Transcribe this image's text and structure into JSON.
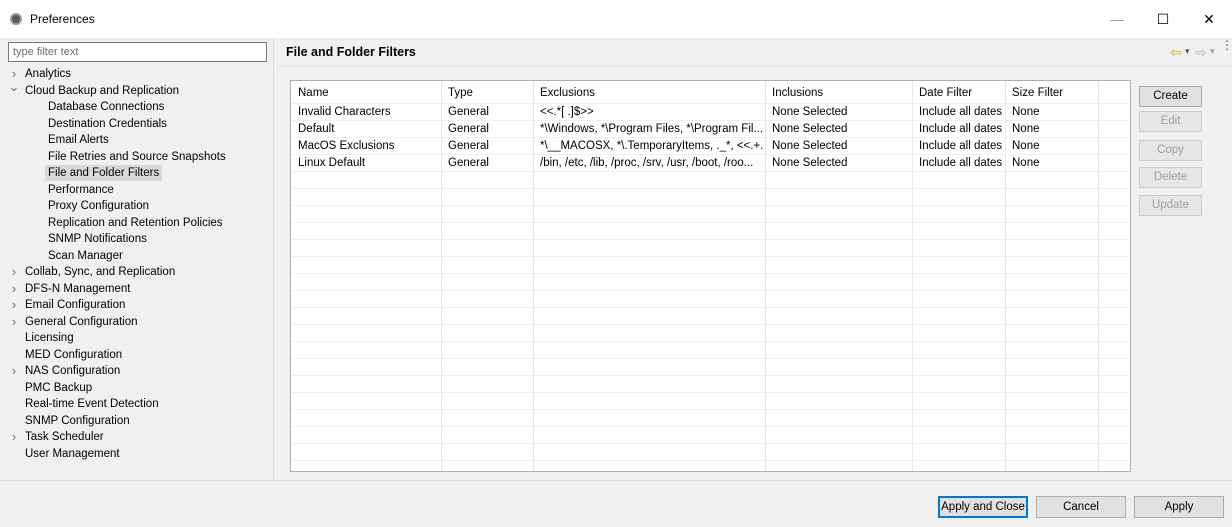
{
  "window": {
    "title": "Preferences",
    "minimize_glyph": "—",
    "maximize_glyph": "☐",
    "close_glyph": "✕"
  },
  "filter": {
    "placeholder": "type filter text",
    "value": ""
  },
  "tree": [
    {
      "label": "Analytics",
      "twisty": ">"
    },
    {
      "label": "Cloud Backup and Replication",
      "twisty": "v"
    },
    {
      "label": "Database Connections",
      "twisty": ""
    },
    {
      "label": "Destination Credentials",
      "twisty": ""
    },
    {
      "label": "Email Alerts",
      "twisty": ""
    },
    {
      "label": "File Retries and Source Snapshots",
      "twisty": ""
    },
    {
      "label": "File and Folder Filters",
      "twisty": "",
      "selected": true
    },
    {
      "label": "Performance",
      "twisty": ""
    },
    {
      "label": "Proxy Configuration",
      "twisty": ""
    },
    {
      "label": "Replication and Retention Policies",
      "twisty": ""
    },
    {
      "label": "SNMP Notifications",
      "twisty": ""
    },
    {
      "label": "Scan Manager",
      "twisty": ""
    },
    {
      "label": "Collab, Sync, and Replication",
      "twisty": ">"
    },
    {
      "label": "DFS-N Management",
      "twisty": ">"
    },
    {
      "label": "Email Configuration",
      "twisty": ">"
    },
    {
      "label": "General Configuration",
      "twisty": ">"
    },
    {
      "label": "Licensing",
      "twisty": ""
    },
    {
      "label": "MED Configuration",
      "twisty": ""
    },
    {
      "label": "NAS Configuration",
      "twisty": ">"
    },
    {
      "label": "PMC Backup",
      "twisty": ""
    },
    {
      "label": "Real-time Event Detection",
      "twisty": ""
    },
    {
      "label": "SNMP Configuration",
      "twisty": ""
    },
    {
      "label": "Task Scheduler",
      "twisty": ">"
    },
    {
      "label": "User Management",
      "twisty": ""
    }
  ],
  "page": {
    "title": "File and Folder Filters",
    "nav_back_glyph": "⇦",
    "nav_forward_glyph": "⇨",
    "dropdown_glyph": "▾",
    "menu_glyph": "⋮"
  },
  "table": {
    "columns": [
      "Name",
      "Type",
      "Exclusions",
      "Inclusions",
      "Date Filter",
      "Size Filter"
    ],
    "rows": [
      [
        "Invalid Characters",
        "General",
        "<<.*[ .]$>>",
        "None Selected",
        "Include all dates",
        "None"
      ],
      [
        "Default",
        "General",
        "*\\Windows, *\\Program Files, *\\Program Fil...",
        "None Selected",
        "Include all dates",
        "None"
      ],
      [
        "MacOS Exclusions",
        "General",
        "*\\__MACOSX, *\\.TemporaryItems, ._*, <<.+...",
        "None Selected",
        "Include all dates",
        "None"
      ],
      [
        "Linux Default",
        "General",
        "/bin, /etc, /lib, /proc, /srv, /usr, /boot, /roo...",
        "None Selected",
        "Include all dates",
        "None"
      ]
    ]
  },
  "actions": {
    "create": "Create",
    "edit": "Edit",
    "copy": "Copy",
    "delete": "Delete",
    "update": "Update"
  },
  "footer": {
    "apply_close": "Apply and Close",
    "cancel": "Cancel",
    "apply": "Apply"
  }
}
